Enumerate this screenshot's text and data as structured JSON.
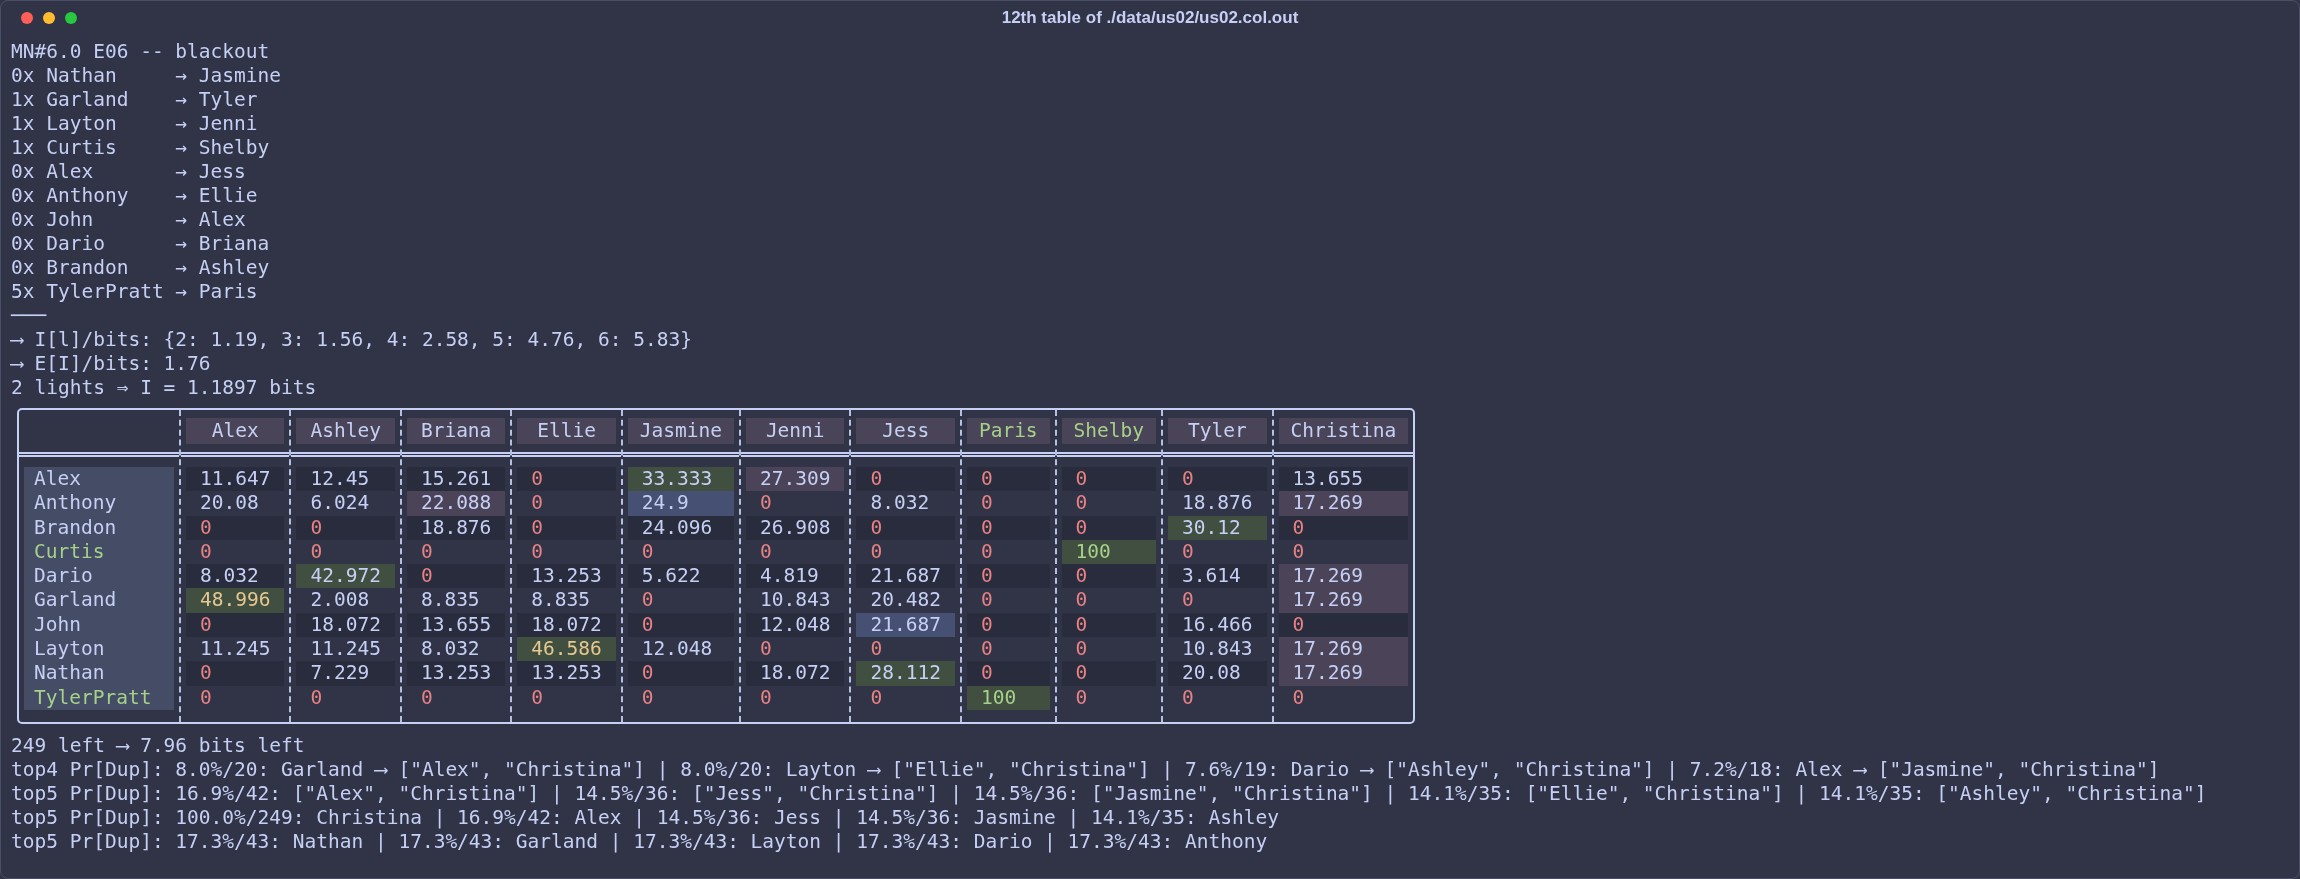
{
  "window": {
    "title": "12th table of ./data/us02/us02.col.out"
  },
  "header_lines": [
    "MN#6.0 E06 -- blackout",
    "0x Nathan     → Jasmine",
    "1x Garland    → Tyler",
    "1x Layton     → Jenni",
    "1x Curtis     → Shelby",
    "0x Alex       → Jess",
    "0x Anthony    → Ellie",
    "0x John       → Alex",
    "0x Dario      → Briana",
    "0x Brandon    → Ashley",
    "5x TylerPratt → Paris",
    "───",
    "⟶ I[l]/bits: {2: 1.19, 3: 1.56, 4: 2.58, 5: 4.76, 6: 5.83}",
    "⟶ E[I]/bits: 1.76",
    "2 lights ⇒ I = 1.1897 bits"
  ],
  "table": {
    "columns": [
      {
        "label": "Alex",
        "matched": false
      },
      {
        "label": "Ashley",
        "matched": false
      },
      {
        "label": "Briana",
        "matched": false
      },
      {
        "label": "Ellie",
        "matched": false
      },
      {
        "label": "Jasmine",
        "matched": false
      },
      {
        "label": "Jenni",
        "matched": false
      },
      {
        "label": "Jess",
        "matched": false
      },
      {
        "label": "Paris",
        "matched": true
      },
      {
        "label": "Shelby",
        "matched": true
      },
      {
        "label": "Tyler",
        "matched": false
      },
      {
        "label": "Christina",
        "matched": false
      }
    ],
    "rows": [
      {
        "name": "Alex",
        "matched": false,
        "cells": [
          {
            "value": "11.647",
            "kind": "plain"
          },
          {
            "value": "12.45",
            "kind": "plain"
          },
          {
            "value": "15.261",
            "kind": "plain"
          },
          {
            "value": "0",
            "kind": "zero"
          },
          {
            "value": "33.333",
            "kind": "green"
          },
          {
            "value": "27.309",
            "kind": "mauve"
          },
          {
            "value": "0",
            "kind": "zero"
          },
          {
            "value": "0",
            "kind": "zero"
          },
          {
            "value": "0",
            "kind": "zero"
          },
          {
            "value": "0",
            "kind": "zero"
          },
          {
            "value": "13.655",
            "kind": "plain"
          }
        ]
      },
      {
        "name": "Anthony",
        "matched": false,
        "cells": [
          {
            "value": "20.08",
            "kind": "plain"
          },
          {
            "value": "6.024",
            "kind": "plain"
          },
          {
            "value": "22.088",
            "kind": "mauve"
          },
          {
            "value": "0",
            "kind": "zero"
          },
          {
            "value": "24.9",
            "kind": "blue"
          },
          {
            "value": "0",
            "kind": "zero"
          },
          {
            "value": "8.032",
            "kind": "plain"
          },
          {
            "value": "0",
            "kind": "zero"
          },
          {
            "value": "0",
            "kind": "zero"
          },
          {
            "value": "18.876",
            "kind": "plain"
          },
          {
            "value": "17.269",
            "kind": "mauve"
          }
        ]
      },
      {
        "name": "Brandon",
        "matched": false,
        "cells": [
          {
            "value": "0",
            "kind": "zero"
          },
          {
            "value": "0",
            "kind": "zero"
          },
          {
            "value": "18.876",
            "kind": "plain"
          },
          {
            "value": "0",
            "kind": "zero"
          },
          {
            "value": "24.096",
            "kind": "plain"
          },
          {
            "value": "26.908",
            "kind": "plain"
          },
          {
            "value": "0",
            "kind": "zero"
          },
          {
            "value": "0",
            "kind": "zero"
          },
          {
            "value": "0",
            "kind": "zero"
          },
          {
            "value": "30.12",
            "kind": "green"
          },
          {
            "value": "0",
            "kind": "zero"
          }
        ]
      },
      {
        "name": "Curtis",
        "matched": true,
        "cells": [
          {
            "value": "0",
            "kind": "zero"
          },
          {
            "value": "0",
            "kind": "zero"
          },
          {
            "value": "0",
            "kind": "zero"
          },
          {
            "value": "0",
            "kind": "zero"
          },
          {
            "value": "0",
            "kind": "zero"
          },
          {
            "value": "0",
            "kind": "zero"
          },
          {
            "value": "0",
            "kind": "zero"
          },
          {
            "value": "0",
            "kind": "zero"
          },
          {
            "value": "100",
            "kind": "match"
          },
          {
            "value": "0",
            "kind": "zero"
          },
          {
            "value": "0",
            "kind": "zero"
          }
        ]
      },
      {
        "name": "Dario",
        "matched": false,
        "cells": [
          {
            "value": "8.032",
            "kind": "plain"
          },
          {
            "value": "42.972",
            "kind": "green"
          },
          {
            "value": "0",
            "kind": "zero"
          },
          {
            "value": "13.253",
            "kind": "plain"
          },
          {
            "value": "5.622",
            "kind": "plain"
          },
          {
            "value": "4.819",
            "kind": "plain"
          },
          {
            "value": "21.687",
            "kind": "plain"
          },
          {
            "value": "0",
            "kind": "zero"
          },
          {
            "value": "0",
            "kind": "zero"
          },
          {
            "value": "3.614",
            "kind": "plain"
          },
          {
            "value": "17.269",
            "kind": "mauve"
          }
        ]
      },
      {
        "name": "Garland",
        "matched": false,
        "cells": [
          {
            "value": "48.996",
            "kind": "gold"
          },
          {
            "value": "2.008",
            "kind": "plain"
          },
          {
            "value": "8.835",
            "kind": "plain"
          },
          {
            "value": "8.835",
            "kind": "plain"
          },
          {
            "value": "0",
            "kind": "zero"
          },
          {
            "value": "10.843",
            "kind": "plain"
          },
          {
            "value": "20.482",
            "kind": "plain"
          },
          {
            "value": "0",
            "kind": "zero"
          },
          {
            "value": "0",
            "kind": "zero"
          },
          {
            "value": "0",
            "kind": "zero"
          },
          {
            "value": "17.269",
            "kind": "mauve"
          }
        ]
      },
      {
        "name": "John",
        "matched": false,
        "cells": [
          {
            "value": "0",
            "kind": "zero"
          },
          {
            "value": "18.072",
            "kind": "plain"
          },
          {
            "value": "13.655",
            "kind": "plain"
          },
          {
            "value": "18.072",
            "kind": "plain"
          },
          {
            "value": "0",
            "kind": "zero"
          },
          {
            "value": "12.048",
            "kind": "plain"
          },
          {
            "value": "21.687",
            "kind": "blue"
          },
          {
            "value": "0",
            "kind": "zero"
          },
          {
            "value": "0",
            "kind": "zero"
          },
          {
            "value": "16.466",
            "kind": "plain"
          },
          {
            "value": "0",
            "kind": "zero"
          }
        ]
      },
      {
        "name": "Layton",
        "matched": false,
        "cells": [
          {
            "value": "11.245",
            "kind": "plain"
          },
          {
            "value": "11.245",
            "kind": "plain"
          },
          {
            "value": "8.032",
            "kind": "plain"
          },
          {
            "value": "46.586",
            "kind": "gold"
          },
          {
            "value": "12.048",
            "kind": "plain"
          },
          {
            "value": "0",
            "kind": "zero"
          },
          {
            "value": "0",
            "kind": "zero"
          },
          {
            "value": "0",
            "kind": "zero"
          },
          {
            "value": "0",
            "kind": "zero"
          },
          {
            "value": "10.843",
            "kind": "plain"
          },
          {
            "value": "17.269",
            "kind": "mauve"
          }
        ]
      },
      {
        "name": "Nathan",
        "matched": false,
        "cells": [
          {
            "value": "0",
            "kind": "zero"
          },
          {
            "value": "7.229",
            "kind": "plain"
          },
          {
            "value": "13.253",
            "kind": "plain"
          },
          {
            "value": "13.253",
            "kind": "plain"
          },
          {
            "value": "0",
            "kind": "zero"
          },
          {
            "value": "18.072",
            "kind": "plain"
          },
          {
            "value": "28.112",
            "kind": "green"
          },
          {
            "value": "0",
            "kind": "zero"
          },
          {
            "value": "0",
            "kind": "zero"
          },
          {
            "value": "20.08",
            "kind": "plain"
          },
          {
            "value": "17.269",
            "kind": "mauve"
          }
        ]
      },
      {
        "name": "TylerPratt",
        "matched": true,
        "cells": [
          {
            "value": "0",
            "kind": "zero"
          },
          {
            "value": "0",
            "kind": "zero"
          },
          {
            "value": "0",
            "kind": "zero"
          },
          {
            "value": "0",
            "kind": "zero"
          },
          {
            "value": "0",
            "kind": "zero"
          },
          {
            "value": "0",
            "kind": "zero"
          },
          {
            "value": "0",
            "kind": "zero"
          },
          {
            "value": "100",
            "kind": "match"
          },
          {
            "value": "0",
            "kind": "zero"
          },
          {
            "value": "0",
            "kind": "zero"
          },
          {
            "value": "0",
            "kind": "zero"
          }
        ]
      }
    ]
  },
  "footer_lines": [
    "249 left ⟶ 7.96 bits left",
    "top4 Pr[Dup]: 8.0%/20: Garland ⟶ [\"Alex\", \"Christina\"] | 8.0%/20: Layton ⟶ [\"Ellie\", \"Christina\"] | 7.6%/19: Dario ⟶ [\"Ashley\", \"Christina\"] | 7.2%/18: Alex ⟶ [\"Jasmine\", \"Christina\"]",
    "top5 Pr[Dup]: 16.9%/42: [\"Alex\", \"Christina\"] | 14.5%/36: [\"Jess\", \"Christina\"] | 14.5%/36: [\"Jasmine\", \"Christina\"] | 14.1%/35: [\"Ellie\", \"Christina\"] | 14.1%/35: [\"Ashley\", \"Christina\"]",
    "top5 Pr[Dup]: 100.0%/249: Christina | 16.9%/42: Alex | 14.5%/36: Jess | 14.5%/36: Jasmine | 14.1%/35: Ashley",
    "top5 Pr[Dup]: 17.3%/43: Nathan | 17.3%/43: Garland | 17.3%/43: Layton | 17.3%/43: Dario | 17.3%/43: Anthony"
  ]
}
